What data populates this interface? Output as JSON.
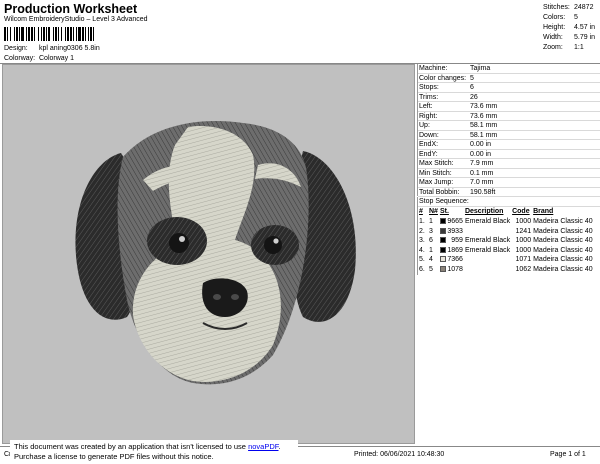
{
  "header": {
    "title": "Production Worksheet",
    "subtitle": "Wilcom EmbroideryStudio – Level 3 Advanced"
  },
  "design": {
    "label": "Design:",
    "value": "kpl aning0306 5.8in"
  },
  "colorway": {
    "label": "Colorway:",
    "value": "Colorway 1"
  },
  "summary": [
    {
      "label": "Stitches:",
      "value": "24872"
    },
    {
      "label": "Colors:",
      "value": "5"
    },
    {
      "label": "Height:",
      "value": "4.57 in"
    },
    {
      "label": "Width:",
      "value": "5.79 in"
    },
    {
      "label": "Zoom:",
      "value": "1:1"
    }
  ],
  "specs": [
    {
      "label": "Machine:",
      "value": "Tajima"
    },
    {
      "label": "Color changes:",
      "value": "5"
    },
    {
      "label": "Stops:",
      "value": "6"
    },
    {
      "label": "Trims:",
      "value": "26"
    },
    {
      "label": "Left:",
      "value": "73.6 mm"
    },
    {
      "label": "Right:",
      "value": "73.6 mm"
    },
    {
      "label": "Up:",
      "value": "58.1 mm"
    },
    {
      "label": "Down:",
      "value": "58.1 mm"
    },
    {
      "label": "EndX:",
      "value": "0.00 in"
    },
    {
      "label": "EndY:",
      "value": "0.00 in"
    },
    {
      "label": "Max Stitch:",
      "value": "7.9 mm"
    },
    {
      "label": "Min Stitch:",
      "value": "0.1 mm"
    },
    {
      "label": "Max Jump:",
      "value": "7.0 mm"
    },
    {
      "label": "Total Bobbin:",
      "value": "190.58ft"
    }
  ],
  "stops": {
    "title": "Stop Sequence:",
    "headers": {
      "num": "#",
      "n": "N#",
      "st": "St.",
      "desc": "Description",
      "code": "Code",
      "brand": "Brand"
    },
    "rows": [
      {
        "num": "1.",
        "n": "1",
        "color": "#000000",
        "st": "9665",
        "desc": "Emerald Black",
        "code": "1000",
        "brand": "Madeira Classic 40"
      },
      {
        "num": "2.",
        "n": "3",
        "color": "#3a3a3a",
        "st": "3933",
        "desc": "",
        "code": "1241",
        "brand": "Madeira Classic 40"
      },
      {
        "num": "3.",
        "n": "6",
        "color": "#000000",
        "st": "959",
        "desc": "Emerald Black",
        "code": "1000",
        "brand": "Madeira Classic 40"
      },
      {
        "num": "4.",
        "n": "1",
        "color": "#000000",
        "st": "1869",
        "desc": "Emerald Black",
        "code": "1000",
        "brand": "Madeira Classic 40"
      },
      {
        "num": "5.",
        "n": "4",
        "color": "#e8e4da",
        "st": "7366",
        "desc": "",
        "code": "1071",
        "brand": "Madeira Classic 40"
      },
      {
        "num": "6.",
        "n": "5",
        "color": "#8a8278",
        "st": "1078",
        "desc": "",
        "code": "1062",
        "brand": "Madeira Classic 40"
      }
    ]
  },
  "notice": {
    "line1_prefix": "This document was created by an application that isn't licensed to use ",
    "link": "novaPDF",
    "line1_suffix": ".",
    "line2": "Purchase a license to generate PDF files without this notice."
  },
  "footer": {
    "left": "Cr",
    "printed": "Printed: 06/06/2021 10:48:30",
    "page": "Page 1 of 1"
  },
  "colors": {
    "background": "#c0c0c0",
    "dark_thread": "#2a2a2a",
    "light_thread": "#d8d8cc"
  }
}
